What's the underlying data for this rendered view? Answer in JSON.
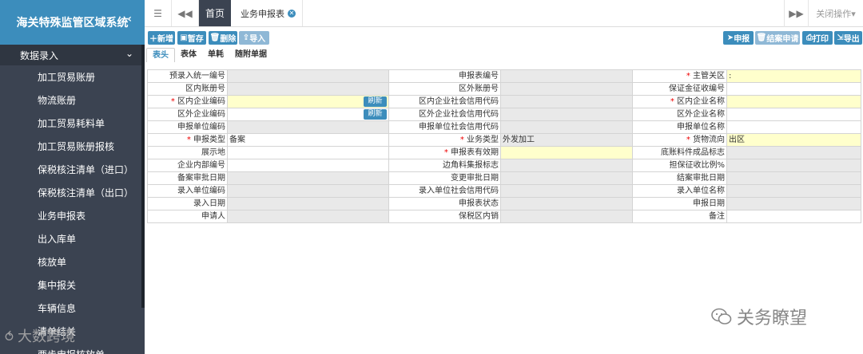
{
  "sidebar": {
    "title": "海关特殊监管区域系统",
    "collapse_icon": "chevron-left-icon",
    "group": "数据录入",
    "items": [
      "加工贸易账册",
      "物流账册",
      "加工贸易耗料单",
      "加工贸易账册报核",
      "保税核注清单（进口）",
      "保税核注清单（出口）",
      "业务申报表",
      "出入库单",
      "核放单",
      "集中报关",
      "车辆信息",
      "清单结关",
      "两步申报核放单"
    ]
  },
  "tabs": {
    "home": "首页",
    "active": "业务申报表",
    "close_ops": "关闭操作▾"
  },
  "toolbar": {
    "left": [
      "新增",
      "暂存",
      "删除",
      "导入"
    ],
    "right": [
      "申报",
      "结案申请",
      "打印",
      "导出"
    ]
  },
  "subtabs": [
    "表头",
    "表体",
    "单耗",
    "随附单据"
  ],
  "form": {
    "refresh": "刷新",
    "rows": [
      {
        "l1": "预录入统一编号",
        "v1": "",
        "l2": "申报表编号",
        "v2": "",
        "l3": "主管关区",
        "v3": ":",
        "r3": true
      },
      {
        "l1": "区内账册号",
        "v1": "",
        "l2": "区外账册号",
        "v2": "",
        "l3": "保证金征收编号",
        "v3": ""
      },
      {
        "l1": "区内企业编码",
        "v1": "",
        "l2": "区内企业社会信用代码",
        "v2": "",
        "l3": "区内企业名称",
        "v3": "",
        "r1": true,
        "r3": true
      },
      {
        "l1": "区外企业编码",
        "v1": "",
        "l2": "区外企业社会信用代码",
        "v2": "",
        "l3": "区外企业名称",
        "v3": ""
      },
      {
        "l1": "申报单位编码",
        "v1": "",
        "l2": "申报单位社会信用代码",
        "v2": "",
        "l3": "申报单位名称",
        "v3": ""
      },
      {
        "l1": "申报类型",
        "v1": "备案",
        "l2": "业务类型",
        "v2": "外发加工",
        "l3": "货物流向",
        "v3": "出区",
        "r1": true,
        "r2": true,
        "r3": true
      },
      {
        "l1": "展示地",
        "v1": "",
        "l2": "申报表有效期",
        "v2": "",
        "l3": "底账料件成品标志",
        "v3": "",
        "r2": true
      },
      {
        "l1": "企业内部编号",
        "v1": "",
        "l2": "边角料集报标志",
        "v2": "",
        "l3": "担保征收比例%",
        "v3": ""
      },
      {
        "l1": "备案审批日期",
        "v1": "",
        "l2": "变更审批日期",
        "v2": "",
        "l3": "结案审批日期",
        "v3": ""
      },
      {
        "l1": "录入单位编码",
        "v1": "",
        "l2": "录入单位社会信用代码",
        "v2": "",
        "l3": "录入单位名称",
        "v3": ""
      },
      {
        "l1": "录入日期",
        "v1": "",
        "l2": "申报表状态",
        "v2": "",
        "l3": "申报日期",
        "v3": ""
      },
      {
        "l1": "申请人",
        "v1": "",
        "l2": "保税区内销",
        "v2": "",
        "l3": "备注",
        "v3": ""
      }
    ]
  },
  "watermark": {
    "right": "关务瞭望",
    "left": "大数跨境"
  }
}
